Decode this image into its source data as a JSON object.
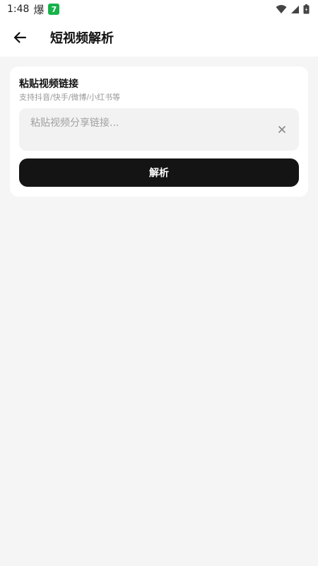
{
  "status_bar": {
    "time": "1:48",
    "notification_glyph": "爆",
    "badge_text": "7",
    "icons": [
      "wifi-icon",
      "cellular-signal-icon",
      "battery-icon"
    ]
  },
  "app_bar": {
    "back_icon": "arrow-left-icon",
    "title": "短视频解析"
  },
  "card": {
    "title": "粘贴视频链接",
    "subtitle": "支持抖音/快手/微博/小红书等",
    "input": {
      "value": "",
      "placeholder": "粘贴视频分享链接..."
    },
    "clear_icon": "close-icon",
    "parse_button_label": "解析"
  },
  "colors": {
    "background": "#f5f5f5",
    "surface": "#ffffff",
    "input_background": "#f2f2f2",
    "primary_button": "#141414",
    "badge_green": "#16b34a",
    "subtitle_text": "#999999"
  }
}
